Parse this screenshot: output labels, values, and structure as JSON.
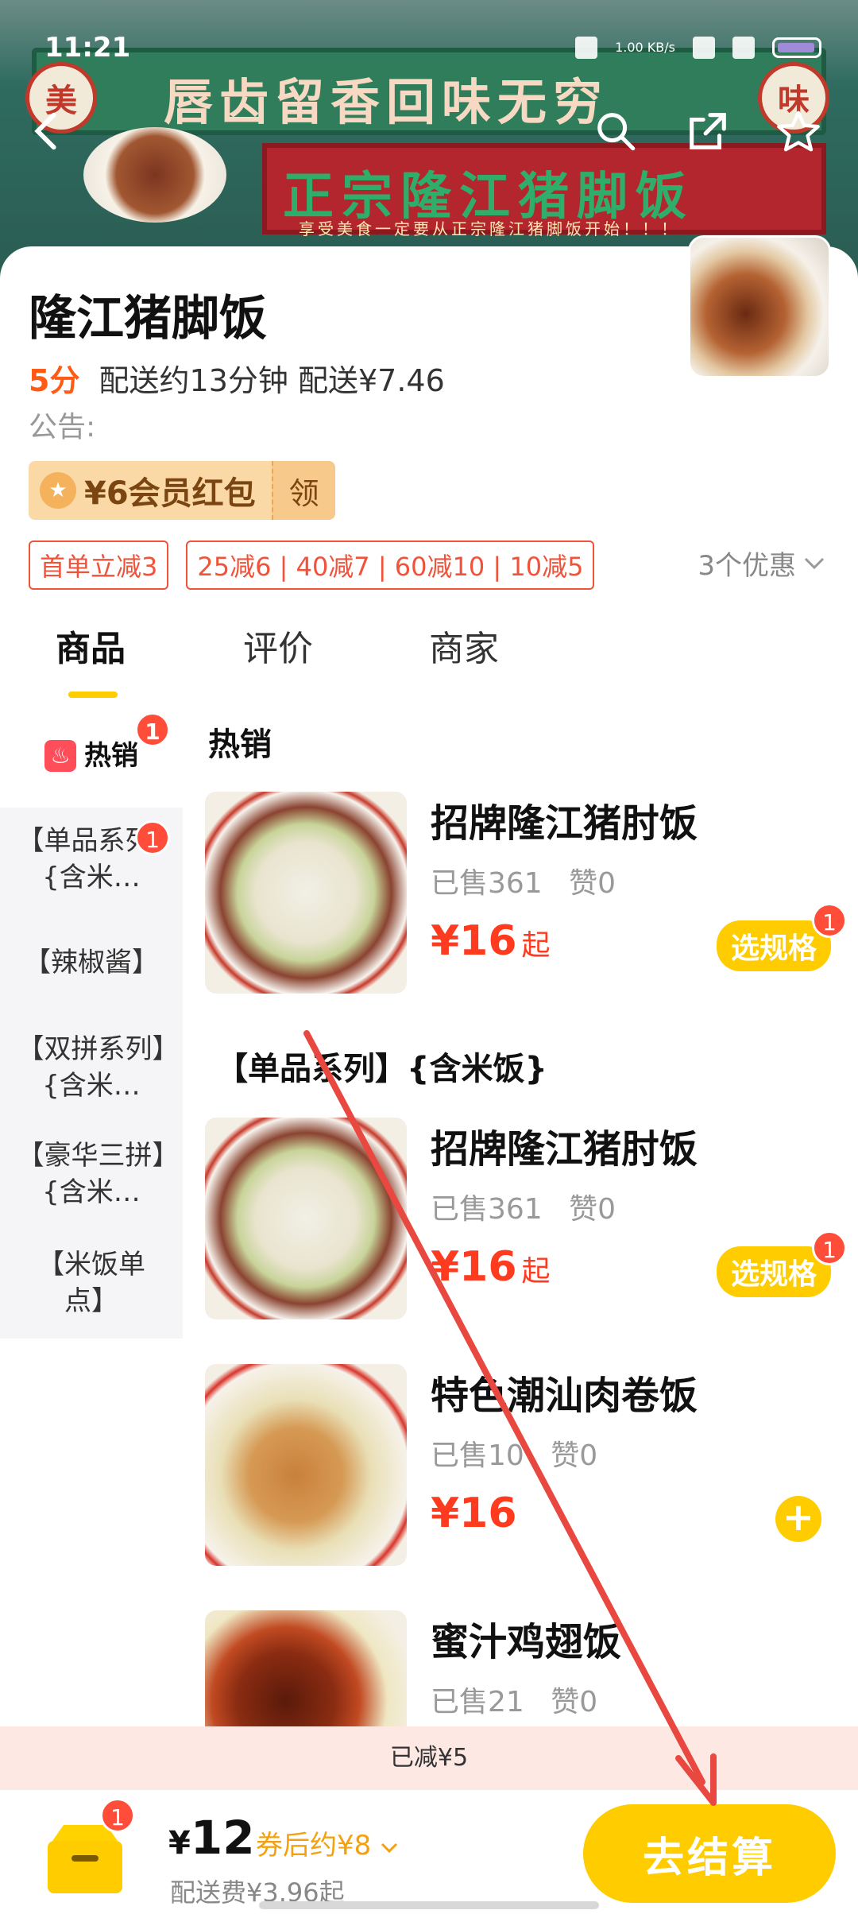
{
  "status_bar": {
    "time": "11:21",
    "speed": "1.00 KB/s"
  },
  "banner": {
    "slogan": "唇齿留香回味无穷",
    "badge_left": "美",
    "badge_right": "味",
    "main_sign": "正宗隆江猪脚饭",
    "sub_sign": "享受美食一定要从正宗隆江猪脚饭开始！！！"
  },
  "shop": {
    "name": "隆江猪脚饭",
    "score": "5分",
    "delivery_info": "配送约13分钟 配送¥7.46",
    "notice": "公告:"
  },
  "member_coupon": {
    "label": "¥6会员红包",
    "action": "领"
  },
  "promos": [
    "首单立减3",
    "25减6 | 40减7 | 60减10 | 10减5"
  ],
  "promo_more": "3个优惠",
  "tabs": [
    "商品",
    "评价",
    "商家"
  ],
  "categories": [
    {
      "label": "热销",
      "badge": "1"
    },
    {
      "label": "【单品系列】{含米…",
      "badge": "1"
    },
    {
      "label": "【辣椒酱】"
    },
    {
      "label": "【双拼系列】{含米…"
    },
    {
      "label": "【豪华三拼】{含米…"
    },
    {
      "label": "【米饭单点】"
    }
  ],
  "sections": [
    {
      "title": "热销"
    },
    {
      "title": "【单品系列】{含米饭}"
    }
  ],
  "products": [
    {
      "name": "招牌隆江猪肘饭",
      "sold": "已售361",
      "likes": "赞0",
      "price": "¥16",
      "suffix": "起",
      "action": "选规格",
      "badge": "1"
    },
    {
      "name": "招牌隆江猪肘饭",
      "sold": "已售361",
      "likes": "赞0",
      "price": "¥16",
      "suffix": "起",
      "action": "选规格",
      "badge": "1"
    },
    {
      "name": "特色潮汕肉卷饭",
      "sold": "已售10",
      "likes": "赞0",
      "price": "¥16"
    },
    {
      "name": "蜜汁鸡翅饭",
      "sold": "已售21",
      "likes": "赞0"
    }
  ],
  "discount_strip": "已减¥5",
  "cart": {
    "badge": "1",
    "total_symbol": "¥",
    "total_value": "12",
    "after_coupon": "券后约¥8",
    "delivery_fee": "配送费¥3.96起",
    "checkout": "去结算"
  },
  "colors": {
    "accent": "#ffcc00",
    "price": "#ff3b1f",
    "promo": "#f0533a",
    "arrow": "#e8483f"
  }
}
